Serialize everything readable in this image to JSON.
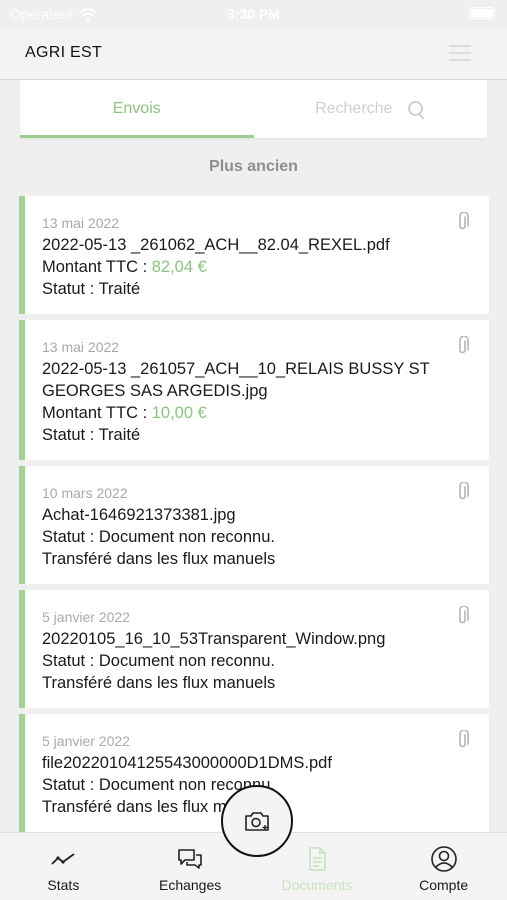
{
  "status_bar": {
    "carrier": "Opérateur",
    "time": "3:30 PM"
  },
  "header": {
    "title": "AGRI EST"
  },
  "tabs": [
    {
      "label": "Envois",
      "active": true
    },
    {
      "label": "Recherche",
      "active": false
    }
  ],
  "sort_label": "Plus ancien",
  "documents": [
    {
      "date": "13 mai 2022",
      "filename": "2022-05-13 _261062_ACH__82.04_REXEL.pdf",
      "amount_label": "Montant TTC :",
      "amount": "82,04 €",
      "status": "Statut : Traité"
    },
    {
      "date": "13 mai 2022",
      "filename": "2022-05-13 _261057_ACH__10_RELAIS BUSSY ST GEORGES SAS ARGEDIS.jpg",
      "amount_label": "Montant TTC :",
      "amount": "10,00 €",
      "status": "Statut : Traité"
    },
    {
      "date": "10 mars 2022",
      "filename": "Achat-1646921373381.jpg",
      "status": "Statut : Document non reconnu.",
      "note": "Transféré dans les flux manuels"
    },
    {
      "date": "5 janvier 2022",
      "filename": "20220105_16_10_53Transparent_Window.png",
      "status": "Statut : Document non reconnu.",
      "note": "Transféré dans les flux manuels"
    },
    {
      "date": "5 janvier 2022",
      "filename": "file20220104125543000000D1DMS.pdf",
      "status": "Statut : Document non reconnu.",
      "note": "Transféré dans les flux manuels"
    }
  ],
  "bottom_nav": [
    {
      "label": "Stats",
      "icon": "chart-line-icon"
    },
    {
      "label": "Echanges",
      "icon": "chat-bubbles-icon"
    },
    {
      "label": "Documents",
      "icon": "document-icon",
      "current": true
    },
    {
      "label": "Compte",
      "icon": "user-circle-icon"
    }
  ],
  "colors": {
    "accent": "#8cc47d",
    "card_border": "#a2d294",
    "nav_current": "#c7e2bf"
  }
}
